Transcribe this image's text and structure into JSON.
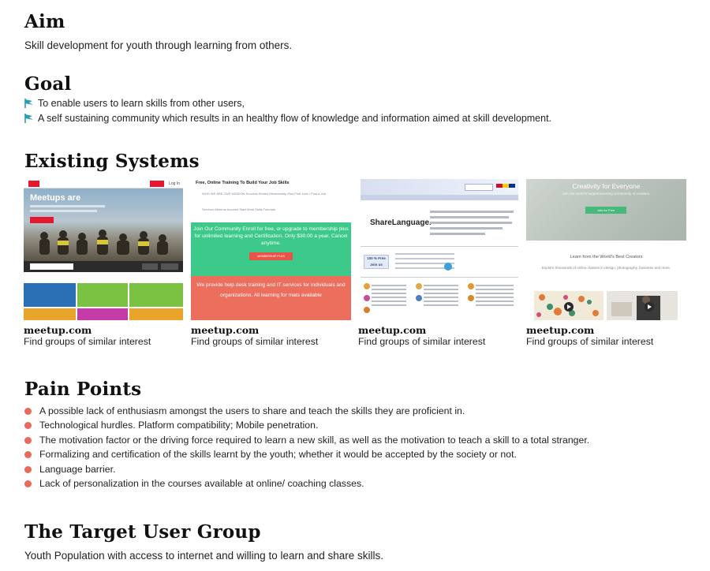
{
  "aim": {
    "heading": "Aim",
    "text": "Skill development for youth through learning from others."
  },
  "goal": {
    "heading": "Goal",
    "items": [
      "To enable users to learn skills from other users,",
      "A self sustaining community which results in an healthy flow of knowledge and information aimed at skill development."
    ]
  },
  "existing": {
    "heading": "Existing Systems",
    "systems": [
      {
        "name": "meetup.com",
        "desc": "Find groups of similar interest"
      },
      {
        "name": "meetup.com",
        "desc": "Find groups of similar interest"
      },
      {
        "name": "meetup.com",
        "desc": "Find groups of similar interest"
      },
      {
        "name": "meetup.com",
        "desc": "Find groups of similar interest"
      }
    ],
    "thumbs": {
      "meetup": {
        "hero": "Meetups are",
        "b1": "Sign Up",
        "b2": "Log In"
      },
      "t2": {
        "title": "Free, Online Training To Build Your Job Skills",
        "nav": "WHO WE ARE   OUR MISSION   Success Stories   Membership Plus   Find Jobs / Post a Job",
        "nav2": "Services   Mentors Account   Start   Work Skills Tutorials",
        "green": "Join Our Community Enroll for free, or upgrade to membership plus for unlimited learning and Certification. Only $30.00 a year. Cancel anytime.",
        "btn": "MEMBERSHIP PLUS",
        "red": "We provide help desk training and IT services for individuals and organizations. All learning for mats available"
      },
      "t3": {
        "logo": "ShareLanguage.",
        "free": "100 % Free Join us"
      },
      "t4": {
        "title": "Creativity for Everyone",
        "sub": "Join the world's largest learning community of creators.",
        "btn": "Join for Free",
        "h2": "Learn from the World's Best Creators",
        "p2": "Explore thousands of online classes in design, photography, business and more."
      }
    }
  },
  "pain": {
    "heading": "Pain Points",
    "items": [
      "A possible lack of enthusiasm amongst the users to share and teach the skills they are proficient in.",
      "Technological hurdles. Platform compatibility; Mobile penetration.",
      "The motivation factor or the driving force required to learn a new skill, as well as the motivation to teach a skill to a total stranger.",
      "Formalizing and certification of the skills learnt by the youth; whether it would be accepted by the society or not.",
      "Language barrier.",
      "Lack of personalization in the courses available at online/ coaching classes."
    ]
  },
  "target": {
    "heading": "The Target User Group",
    "text": "Youth Population with access to internet and willing to learn and share skills."
  },
  "colors": {
    "bullet": "#e86a5c",
    "flag": "#2a9bb7"
  }
}
